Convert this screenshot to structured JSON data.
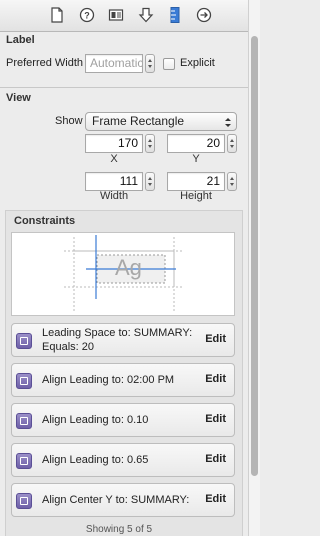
{
  "toolbar": {
    "icons": [
      "file-inspector-icon",
      "help-icon",
      "identity-inspector-icon",
      "attributes-inspector-icon",
      "size-inspector-icon",
      "connections-inspector-icon"
    ],
    "active": "size-inspector-icon",
    "accent": "#3a7bd5"
  },
  "label_section": {
    "title": "Label",
    "preferred_width_label": "Preferred Width",
    "preferred_width_placeholder": "Automatic",
    "explicit_label": "Explicit",
    "explicit_checked": false
  },
  "view_section": {
    "title": "View",
    "show_label": "Show",
    "show_value": "Frame Rectangle",
    "x": "170",
    "x_label": "X",
    "y": "20",
    "y_label": "Y",
    "width": "111",
    "width_label": "Width",
    "height": "21",
    "height_label": "Height"
  },
  "constraints": {
    "title": "Constraints",
    "preview_text": "Ag",
    "rows": [
      {
        "line1": "Leading Space to:  SUMMARY:",
        "line2": "Equals:  20",
        "edit": "Edit"
      },
      {
        "line1": "Align Leading to:  02:00 PM",
        "line2": "",
        "edit": "Edit"
      },
      {
        "line1": "Align Leading to:  0.10",
        "line2": "",
        "edit": "Edit"
      },
      {
        "line1": "Align Leading to:  0.65",
        "line2": "",
        "edit": "Edit"
      },
      {
        "line1": "Align Center Y to:  SUMMARY:",
        "line2": "",
        "edit": "Edit"
      }
    ],
    "footer": "Showing 5 of 5"
  }
}
